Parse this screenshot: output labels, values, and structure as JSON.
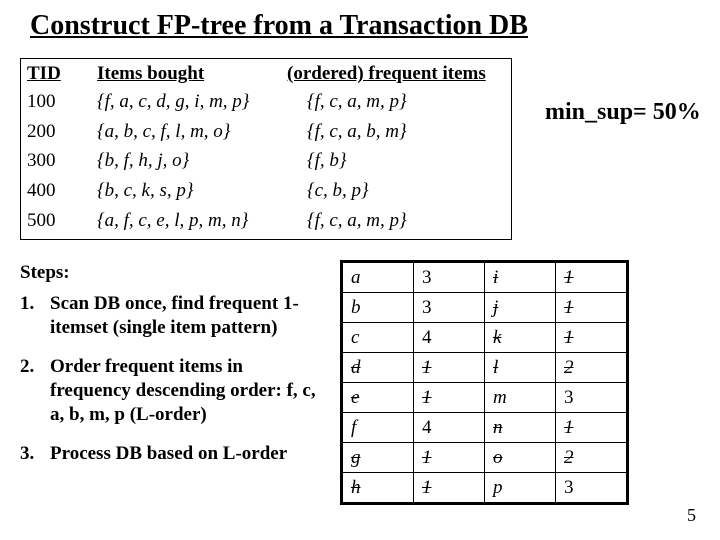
{
  "title": "Construct FP-tree from a Transaction DB",
  "db": {
    "headers": {
      "tid": "TID",
      "items": "Items bought",
      "ordered": "(ordered) frequent items"
    },
    "rows": [
      {
        "tid": "100",
        "items": "{f, a, c, d, g, i, m, p}",
        "ordered": "{f, c, a, m, p}"
      },
      {
        "tid": "200",
        "items": "{a, b, c, f, l, m, o}",
        "ordered": "{f, c, a, b, m}"
      },
      {
        "tid": "300",
        "items": "{b, f, h, j, o}",
        "ordered": "{f, b}"
      },
      {
        "tid": "400",
        "items": "{b, c, k, s, p}",
        "ordered": "{c, b, p}"
      },
      {
        "tid": "500",
        "items": "{a, f, c, e, l, p, m, n}",
        "ordered": "{f, c, a, m, p}"
      }
    ]
  },
  "min_sup": "min_sup= 50%",
  "steps_label": "Steps:",
  "steps": [
    {
      "n": "1.",
      "text": "Scan DB once, find frequent 1-itemset (single item pattern)"
    },
    {
      "n": "2.",
      "text": "Order frequent items in frequency descending order: f, c, a, b, m, p (L-order)"
    },
    {
      "n": "3.",
      "text": "Process DB based on L-order"
    }
  ],
  "freq": [
    {
      "i1": "a",
      "c1": "3",
      "i2": "i",
      "c2": "1",
      "s1": false,
      "s2": true
    },
    {
      "i1": "b",
      "c1": "3",
      "i2": "j",
      "c2": "1",
      "s1": false,
      "s2": true
    },
    {
      "i1": "c",
      "c1": "4",
      "i2": "k",
      "c2": "1",
      "s1": false,
      "s2": true
    },
    {
      "i1": "d",
      "c1": "1",
      "i2": "l",
      "c2": "2",
      "s1": true,
      "s2": true
    },
    {
      "i1": "e",
      "c1": "1",
      "i2": "m",
      "c2": "3",
      "s1": true,
      "s2": false
    },
    {
      "i1": "f",
      "c1": "4",
      "i2": "n",
      "c2": "1",
      "s1": false,
      "s2": true
    },
    {
      "i1": "g",
      "c1": "1",
      "i2": "o",
      "c2": "2",
      "s1": true,
      "s2": true
    },
    {
      "i1": "h",
      "c1": "1",
      "i2": "p",
      "c2": "3",
      "s1": true,
      "s2": false
    }
  ],
  "page_number": "5"
}
